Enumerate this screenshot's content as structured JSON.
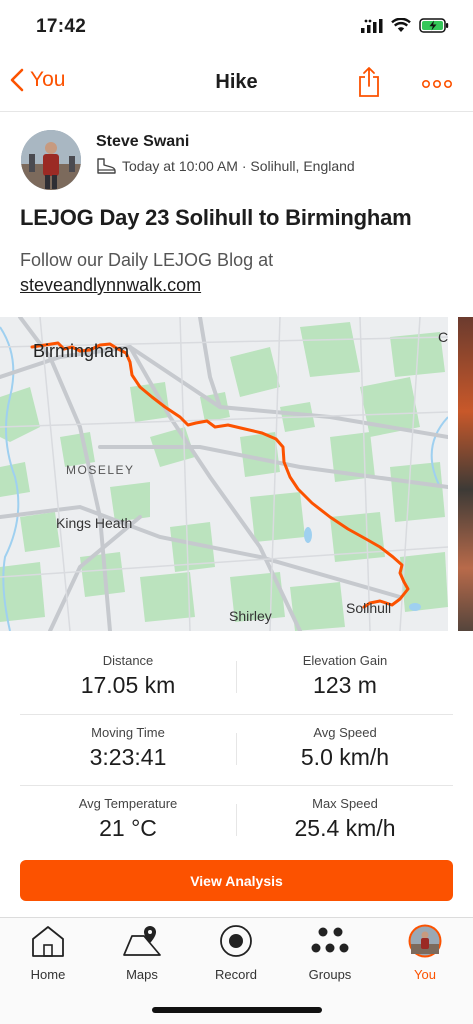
{
  "status_bar": {
    "time": "17:42"
  },
  "nav": {
    "back_label": "You",
    "title": "Hike"
  },
  "activity": {
    "athlete": "Steve Swani",
    "meta": "Today at 10:00 AM · Solihull, England",
    "title": "LEJOG Day 23 Solihull to Birmingham",
    "description": "Follow our Daily LEJOG Blog at",
    "link": "steveandlynnwalk.com"
  },
  "map": {
    "labels": {
      "birmingham": "Birmingham",
      "moseley": "MOSELEY",
      "kings_heath": "Kings Heath",
      "shirley": "Shirley",
      "solihull": "Solihull",
      "corner_c": "C"
    },
    "route_color": "#fc5200"
  },
  "stats": [
    {
      "label": "Distance",
      "value": "17.05 km"
    },
    {
      "label": "Elevation Gain",
      "value": "123 m"
    },
    {
      "label": "Moving Time",
      "value": "3:23:41"
    },
    {
      "label": "Avg Speed",
      "value": "5.0 km/h"
    },
    {
      "label": "Avg Temperature",
      "value": "21 °C"
    },
    {
      "label": "Max Speed",
      "value": "25.4 km/h"
    }
  ],
  "cta": {
    "label": "View Analysis"
  },
  "tabs": [
    {
      "label": "Home",
      "icon": "home-icon"
    },
    {
      "label": "Maps",
      "icon": "map-icon"
    },
    {
      "label": "Record",
      "icon": "record-icon"
    },
    {
      "label": "Groups",
      "icon": "groups-icon"
    },
    {
      "label": "You",
      "icon": "avatar"
    }
  ],
  "colors": {
    "accent": "#fc5200",
    "map_green": "#b9e3bc",
    "map_water": "#9fd0f0"
  }
}
